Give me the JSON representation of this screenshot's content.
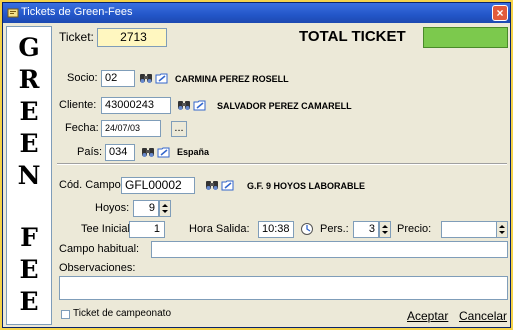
{
  "window": {
    "title": "Tickets de Green-Fees",
    "close": "×"
  },
  "sidebar_letters": [
    "G",
    "R",
    "E",
    "E",
    "N",
    "F",
    "E",
    "E"
  ],
  "ticket": {
    "label": "Ticket:",
    "value": "2713",
    "total_label": "TOTAL TICKET",
    "total_value": ""
  },
  "socio": {
    "label": "Socio:",
    "value": "02",
    "name": "CARMINA PEREZ ROSELL"
  },
  "cliente": {
    "label": "Cliente:",
    "value": "43000243",
    "name": "SALVADOR PEREZ CAMARELL"
  },
  "fecha": {
    "label": "Fecha:",
    "value": "24/07/03",
    "button": "..."
  },
  "pais": {
    "label": "País:",
    "value": "034",
    "name": "España"
  },
  "campo": {
    "label": "Cód. Campo:",
    "value": "GFL00002",
    "name": "G.F. 9 HOYOS LABORABLE"
  },
  "hoyos": {
    "label": "Hoyos:",
    "value": "9"
  },
  "tee": {
    "label": "Tee Inicial:",
    "value": "1"
  },
  "hora": {
    "label": "Hora Salida:",
    "value": "10:38"
  },
  "pers": {
    "label": "Pers.:",
    "value": "3"
  },
  "precio": {
    "label": "Precio:",
    "value": ""
  },
  "campo_habitual": {
    "label": "Campo habitual:",
    "value": ""
  },
  "observaciones": {
    "label": "Observaciones:",
    "value": ""
  },
  "campeonato": {
    "label": "Ticket de campeonato"
  },
  "buttons": {
    "aceptar": "Aceptar",
    "cancelar": "Cancelar"
  },
  "colors": {
    "ticket_bg": "#fff7c0",
    "total_bg": "#7cc94d",
    "window_bg": "#ece9d8",
    "titlebar": "#2356c8",
    "outer": "#f5d34a"
  }
}
